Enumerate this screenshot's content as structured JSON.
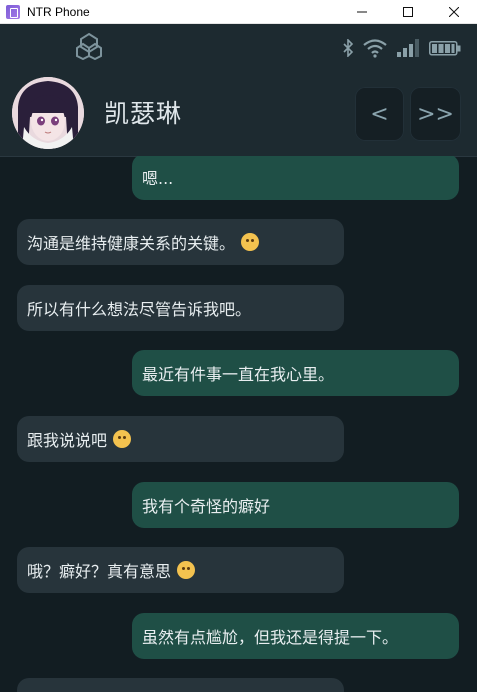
{
  "window": {
    "title": "NTR Phone"
  },
  "contact": {
    "name": "凯瑟琳"
  },
  "nav": {
    "prev_label": "<",
    "next_label": ">>"
  },
  "messages": [
    {
      "side": "me",
      "text": "嗯..."
    },
    {
      "side": "them",
      "text": "沟通是维持健康关系的关键。",
      "emoji": "hugging-face-emoji"
    },
    {
      "side": "them",
      "text": "所以有什么想法尽管告诉我吧。"
    },
    {
      "side": "me",
      "text": "最近有件事一直在我心里。"
    },
    {
      "side": "them",
      "text": "跟我说说吧",
      "emoji": "smiling-face-emoji"
    },
    {
      "side": "me",
      "text": "我有个奇怪的癖好"
    },
    {
      "side": "them",
      "text": "哦？癖好？真有意思",
      "emoji": "winking-tongue-emoji"
    },
    {
      "side": "me",
      "text": "虽然有点尴尬，但我还是得提一下。"
    }
  ]
}
